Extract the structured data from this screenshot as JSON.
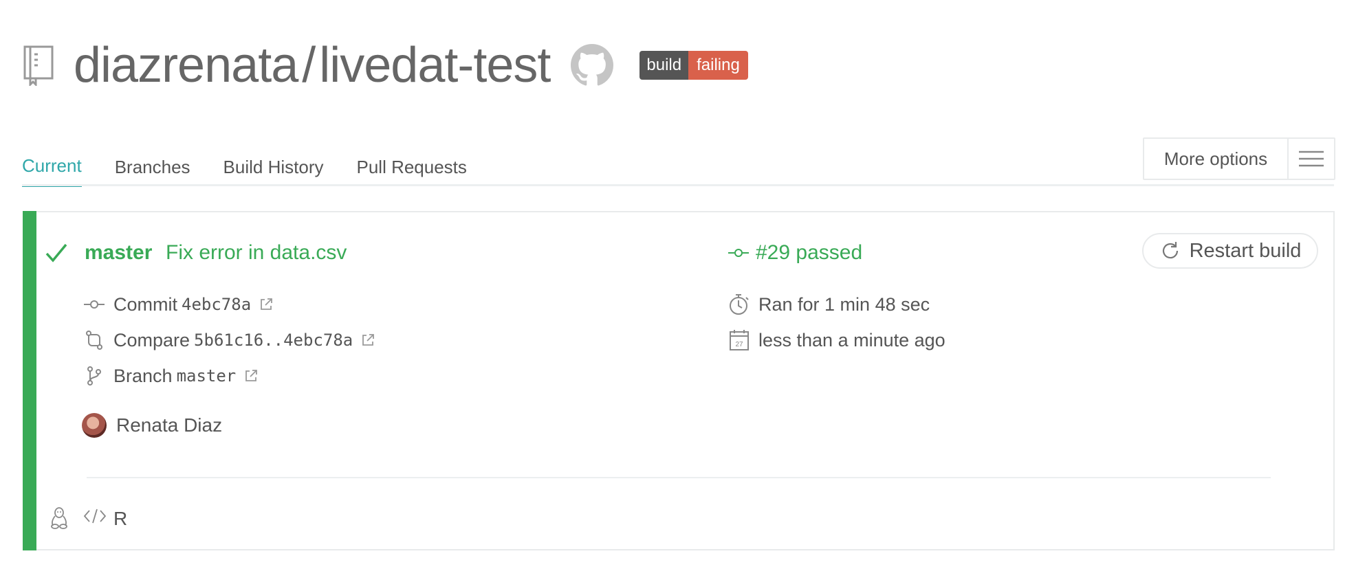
{
  "repo": {
    "owner": "diazrenata",
    "separator": "/",
    "name": "livedat-test",
    "badge": {
      "label": "build",
      "status": "failing"
    }
  },
  "tabs": [
    {
      "label": "Current",
      "active": true
    },
    {
      "label": "Branches",
      "active": false
    },
    {
      "label": "Build History",
      "active": false
    },
    {
      "label": "Pull Requests",
      "active": false
    }
  ],
  "more_options": {
    "label": "More options"
  },
  "build": {
    "branch": "master",
    "message": "Fix error in data.csv",
    "status": "#29 passed",
    "restart_label": "Restart build",
    "commit": {
      "label": "Commit",
      "value": "4ebc78a"
    },
    "compare": {
      "label": "Compare",
      "value": "5b61c16..4ebc78a"
    },
    "branch_meta": {
      "label": "Branch",
      "value": "master"
    },
    "duration": "Ran for 1 min 48 sec",
    "finished": "less than a minute ago",
    "calendar_day": "27",
    "author": "Renata Diaz",
    "language": "R"
  },
  "colors": {
    "passed": "#39aa56",
    "tab_active": "#2fa7a9",
    "badge_label": "#555555",
    "badge_failing": "#d9614b"
  },
  "icons": [
    "repo-icon",
    "github-icon",
    "hamburger-icon",
    "check-icon",
    "commit-icon",
    "restart-icon",
    "compare-icon",
    "branch-icon",
    "stopwatch-icon",
    "calendar-icon",
    "external-link-icon",
    "linux-icon",
    "code-icon"
  ]
}
